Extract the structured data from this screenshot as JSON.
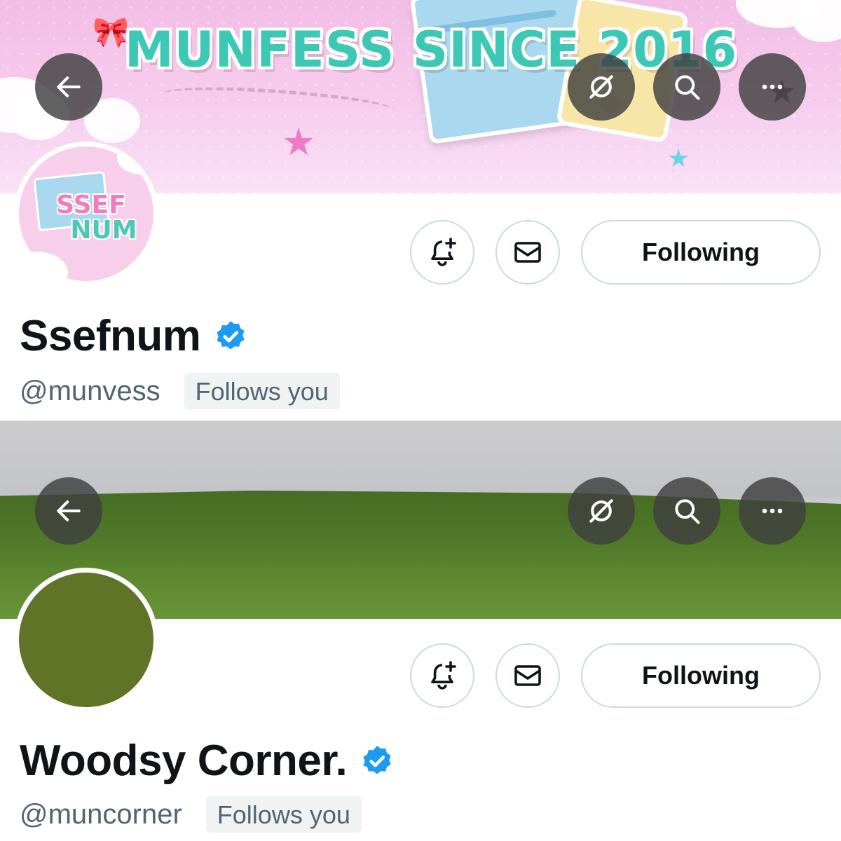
{
  "profiles": [
    {
      "display_name": "Ssefnum",
      "handle": "@munvess",
      "follows_you": "Follows you",
      "verified": true,
      "banner_headline": "MUNFESS SINCE 2016",
      "avatar_text_line1": "SSEF",
      "avatar_text_line2": "NUM",
      "follow_state": "Following"
    },
    {
      "display_name": "Woodsy Corner.",
      "handle": "@muncorner",
      "follows_you": "Follows you",
      "verified": true,
      "avatar_color": "#5f7426",
      "follow_state": "Following"
    }
  ],
  "icons": {
    "back": "arrow-left-icon",
    "grok": "grok-icon",
    "search": "search-icon",
    "more": "more-options-icon",
    "notify": "bell-plus-icon",
    "message": "envelope-icon",
    "verified": "verified-badge-icon"
  },
  "colors": {
    "verified_blue": "#1d9bf0",
    "text_primary": "#0f1419",
    "text_secondary": "#536471",
    "border": "#cfd9de",
    "badge_bg": "#eff3f4"
  }
}
